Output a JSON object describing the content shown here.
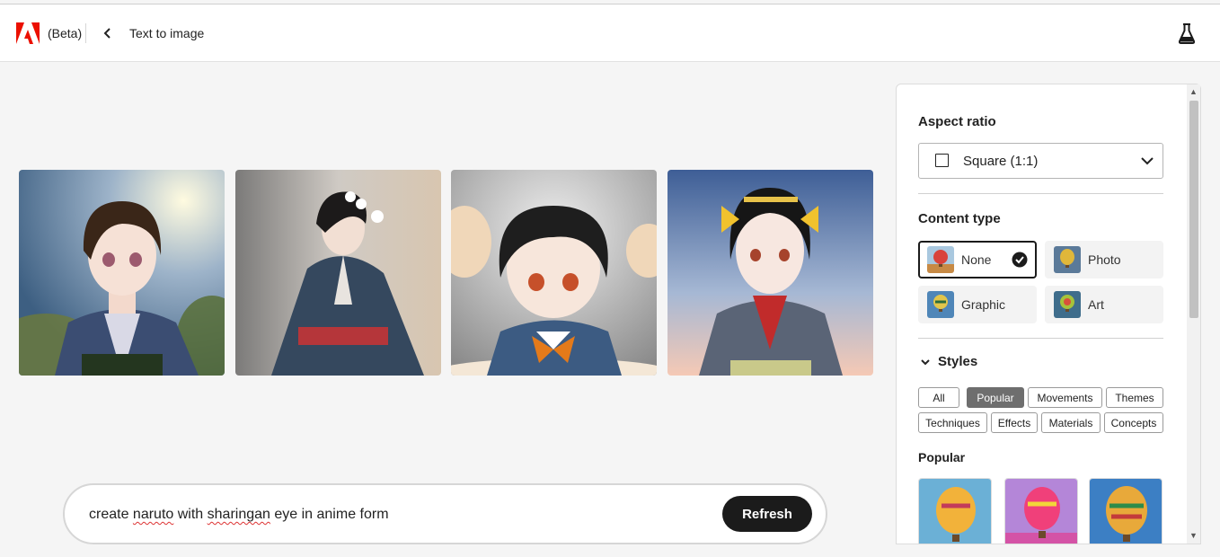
{
  "header": {
    "beta_label": "(Beta)",
    "title": "Text to image",
    "icons": [
      "adobe-logo",
      "chevron-left-icon",
      "flask-icon"
    ]
  },
  "gallery": {
    "images": [
      {
        "name": "generated-image-1",
        "description_icon": "anime-portrait"
      },
      {
        "name": "generated-image-2",
        "description_icon": "anime-portrait"
      },
      {
        "name": "generated-image-3",
        "description_icon": "anime-portrait"
      },
      {
        "name": "generated-image-4",
        "description_icon": "anime-portrait"
      }
    ]
  },
  "prompt": {
    "w1": "create ",
    "w2": "naruto",
    "w3": " with ",
    "w4": "sharingan",
    "w5": " eye in anime form",
    "refresh_label": "Refresh"
  },
  "panel": {
    "aspect_ratio_title": "Aspect ratio",
    "aspect_ratio_value": "Square (1:1)",
    "content_type_title": "Content type",
    "content_types": [
      {
        "label": "None",
        "selected": true
      },
      {
        "label": "Photo",
        "selected": false
      },
      {
        "label": "Graphic",
        "selected": false
      },
      {
        "label": "Art",
        "selected": false
      }
    ],
    "styles_title": "Styles",
    "style_chips": [
      {
        "label": "All",
        "active": false
      },
      {
        "label": "Popular",
        "active": true
      },
      {
        "label": "Movements",
        "active": false
      },
      {
        "label": "Themes",
        "active": false
      },
      {
        "label": "Techniques",
        "active": false
      },
      {
        "label": "Effects",
        "active": false
      },
      {
        "label": "Materials",
        "active": false
      },
      {
        "label": "Concepts",
        "active": false
      }
    ],
    "popular_title": "Popular"
  },
  "colors": {
    "accent_dark": "#1b1b1b",
    "adobe_red": "#eb1000",
    "chip_active": "#6e6e6e"
  }
}
